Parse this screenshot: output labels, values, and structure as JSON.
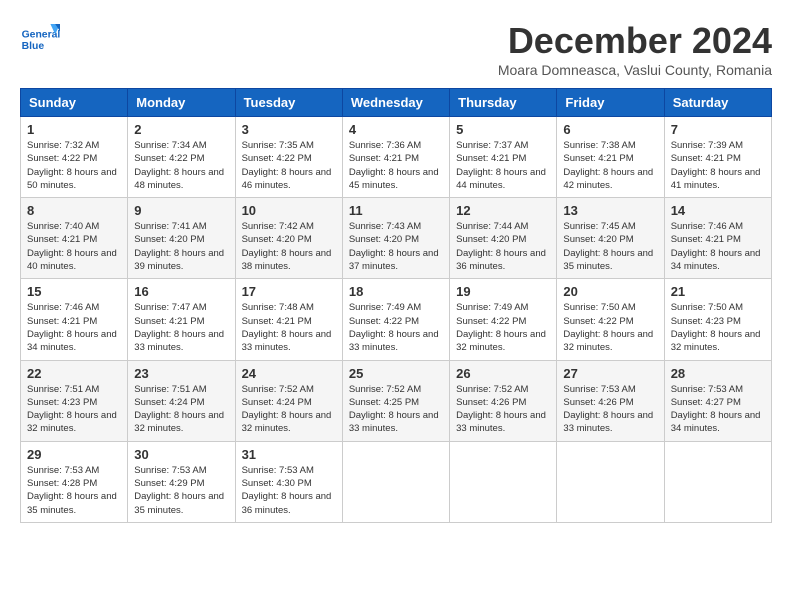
{
  "header": {
    "logo_line1": "General",
    "logo_line2": "Blue",
    "month": "December 2024",
    "location": "Moara Domneasca, Vaslui County, Romania"
  },
  "weekdays": [
    "Sunday",
    "Monday",
    "Tuesday",
    "Wednesday",
    "Thursday",
    "Friday",
    "Saturday"
  ],
  "weeks": [
    [
      {
        "day": "1",
        "sunrise": "7:32 AM",
        "sunset": "4:22 PM",
        "daylight": "8 hours and 50 minutes."
      },
      {
        "day": "2",
        "sunrise": "7:34 AM",
        "sunset": "4:22 PM",
        "daylight": "8 hours and 48 minutes."
      },
      {
        "day": "3",
        "sunrise": "7:35 AM",
        "sunset": "4:22 PM",
        "daylight": "8 hours and 46 minutes."
      },
      {
        "day": "4",
        "sunrise": "7:36 AM",
        "sunset": "4:21 PM",
        "daylight": "8 hours and 45 minutes."
      },
      {
        "day": "5",
        "sunrise": "7:37 AM",
        "sunset": "4:21 PM",
        "daylight": "8 hours and 44 minutes."
      },
      {
        "day": "6",
        "sunrise": "7:38 AM",
        "sunset": "4:21 PM",
        "daylight": "8 hours and 42 minutes."
      },
      {
        "day": "7",
        "sunrise": "7:39 AM",
        "sunset": "4:21 PM",
        "daylight": "8 hours and 41 minutes."
      }
    ],
    [
      {
        "day": "8",
        "sunrise": "7:40 AM",
        "sunset": "4:21 PM",
        "daylight": "8 hours and 40 minutes."
      },
      {
        "day": "9",
        "sunrise": "7:41 AM",
        "sunset": "4:20 PM",
        "daylight": "8 hours and 39 minutes."
      },
      {
        "day": "10",
        "sunrise": "7:42 AM",
        "sunset": "4:20 PM",
        "daylight": "8 hours and 38 minutes."
      },
      {
        "day": "11",
        "sunrise": "7:43 AM",
        "sunset": "4:20 PM",
        "daylight": "8 hours and 37 minutes."
      },
      {
        "day": "12",
        "sunrise": "7:44 AM",
        "sunset": "4:20 PM",
        "daylight": "8 hours and 36 minutes."
      },
      {
        "day": "13",
        "sunrise": "7:45 AM",
        "sunset": "4:20 PM",
        "daylight": "8 hours and 35 minutes."
      },
      {
        "day": "14",
        "sunrise": "7:46 AM",
        "sunset": "4:21 PM",
        "daylight": "8 hours and 34 minutes."
      }
    ],
    [
      {
        "day": "15",
        "sunrise": "7:46 AM",
        "sunset": "4:21 PM",
        "daylight": "8 hours and 34 minutes."
      },
      {
        "day": "16",
        "sunrise": "7:47 AM",
        "sunset": "4:21 PM",
        "daylight": "8 hours and 33 minutes."
      },
      {
        "day": "17",
        "sunrise": "7:48 AM",
        "sunset": "4:21 PM",
        "daylight": "8 hours and 33 minutes."
      },
      {
        "day": "18",
        "sunrise": "7:49 AM",
        "sunset": "4:22 PM",
        "daylight": "8 hours and 33 minutes."
      },
      {
        "day": "19",
        "sunrise": "7:49 AM",
        "sunset": "4:22 PM",
        "daylight": "8 hours and 32 minutes."
      },
      {
        "day": "20",
        "sunrise": "7:50 AM",
        "sunset": "4:22 PM",
        "daylight": "8 hours and 32 minutes."
      },
      {
        "day": "21",
        "sunrise": "7:50 AM",
        "sunset": "4:23 PM",
        "daylight": "8 hours and 32 minutes."
      }
    ],
    [
      {
        "day": "22",
        "sunrise": "7:51 AM",
        "sunset": "4:23 PM",
        "daylight": "8 hours and 32 minutes."
      },
      {
        "day": "23",
        "sunrise": "7:51 AM",
        "sunset": "4:24 PM",
        "daylight": "8 hours and 32 minutes."
      },
      {
        "day": "24",
        "sunrise": "7:52 AM",
        "sunset": "4:24 PM",
        "daylight": "8 hours and 32 minutes."
      },
      {
        "day": "25",
        "sunrise": "7:52 AM",
        "sunset": "4:25 PM",
        "daylight": "8 hours and 33 minutes."
      },
      {
        "day": "26",
        "sunrise": "7:52 AM",
        "sunset": "4:26 PM",
        "daylight": "8 hours and 33 minutes."
      },
      {
        "day": "27",
        "sunrise": "7:53 AM",
        "sunset": "4:26 PM",
        "daylight": "8 hours and 33 minutes."
      },
      {
        "day": "28",
        "sunrise": "7:53 AM",
        "sunset": "4:27 PM",
        "daylight": "8 hours and 34 minutes."
      }
    ],
    [
      {
        "day": "29",
        "sunrise": "7:53 AM",
        "sunset": "4:28 PM",
        "daylight": "8 hours and 35 minutes."
      },
      {
        "day": "30",
        "sunrise": "7:53 AM",
        "sunset": "4:29 PM",
        "daylight": "8 hours and 35 minutes."
      },
      {
        "day": "31",
        "sunrise": "7:53 AM",
        "sunset": "4:30 PM",
        "daylight": "8 hours and 36 minutes."
      },
      null,
      null,
      null,
      null
    ]
  ]
}
